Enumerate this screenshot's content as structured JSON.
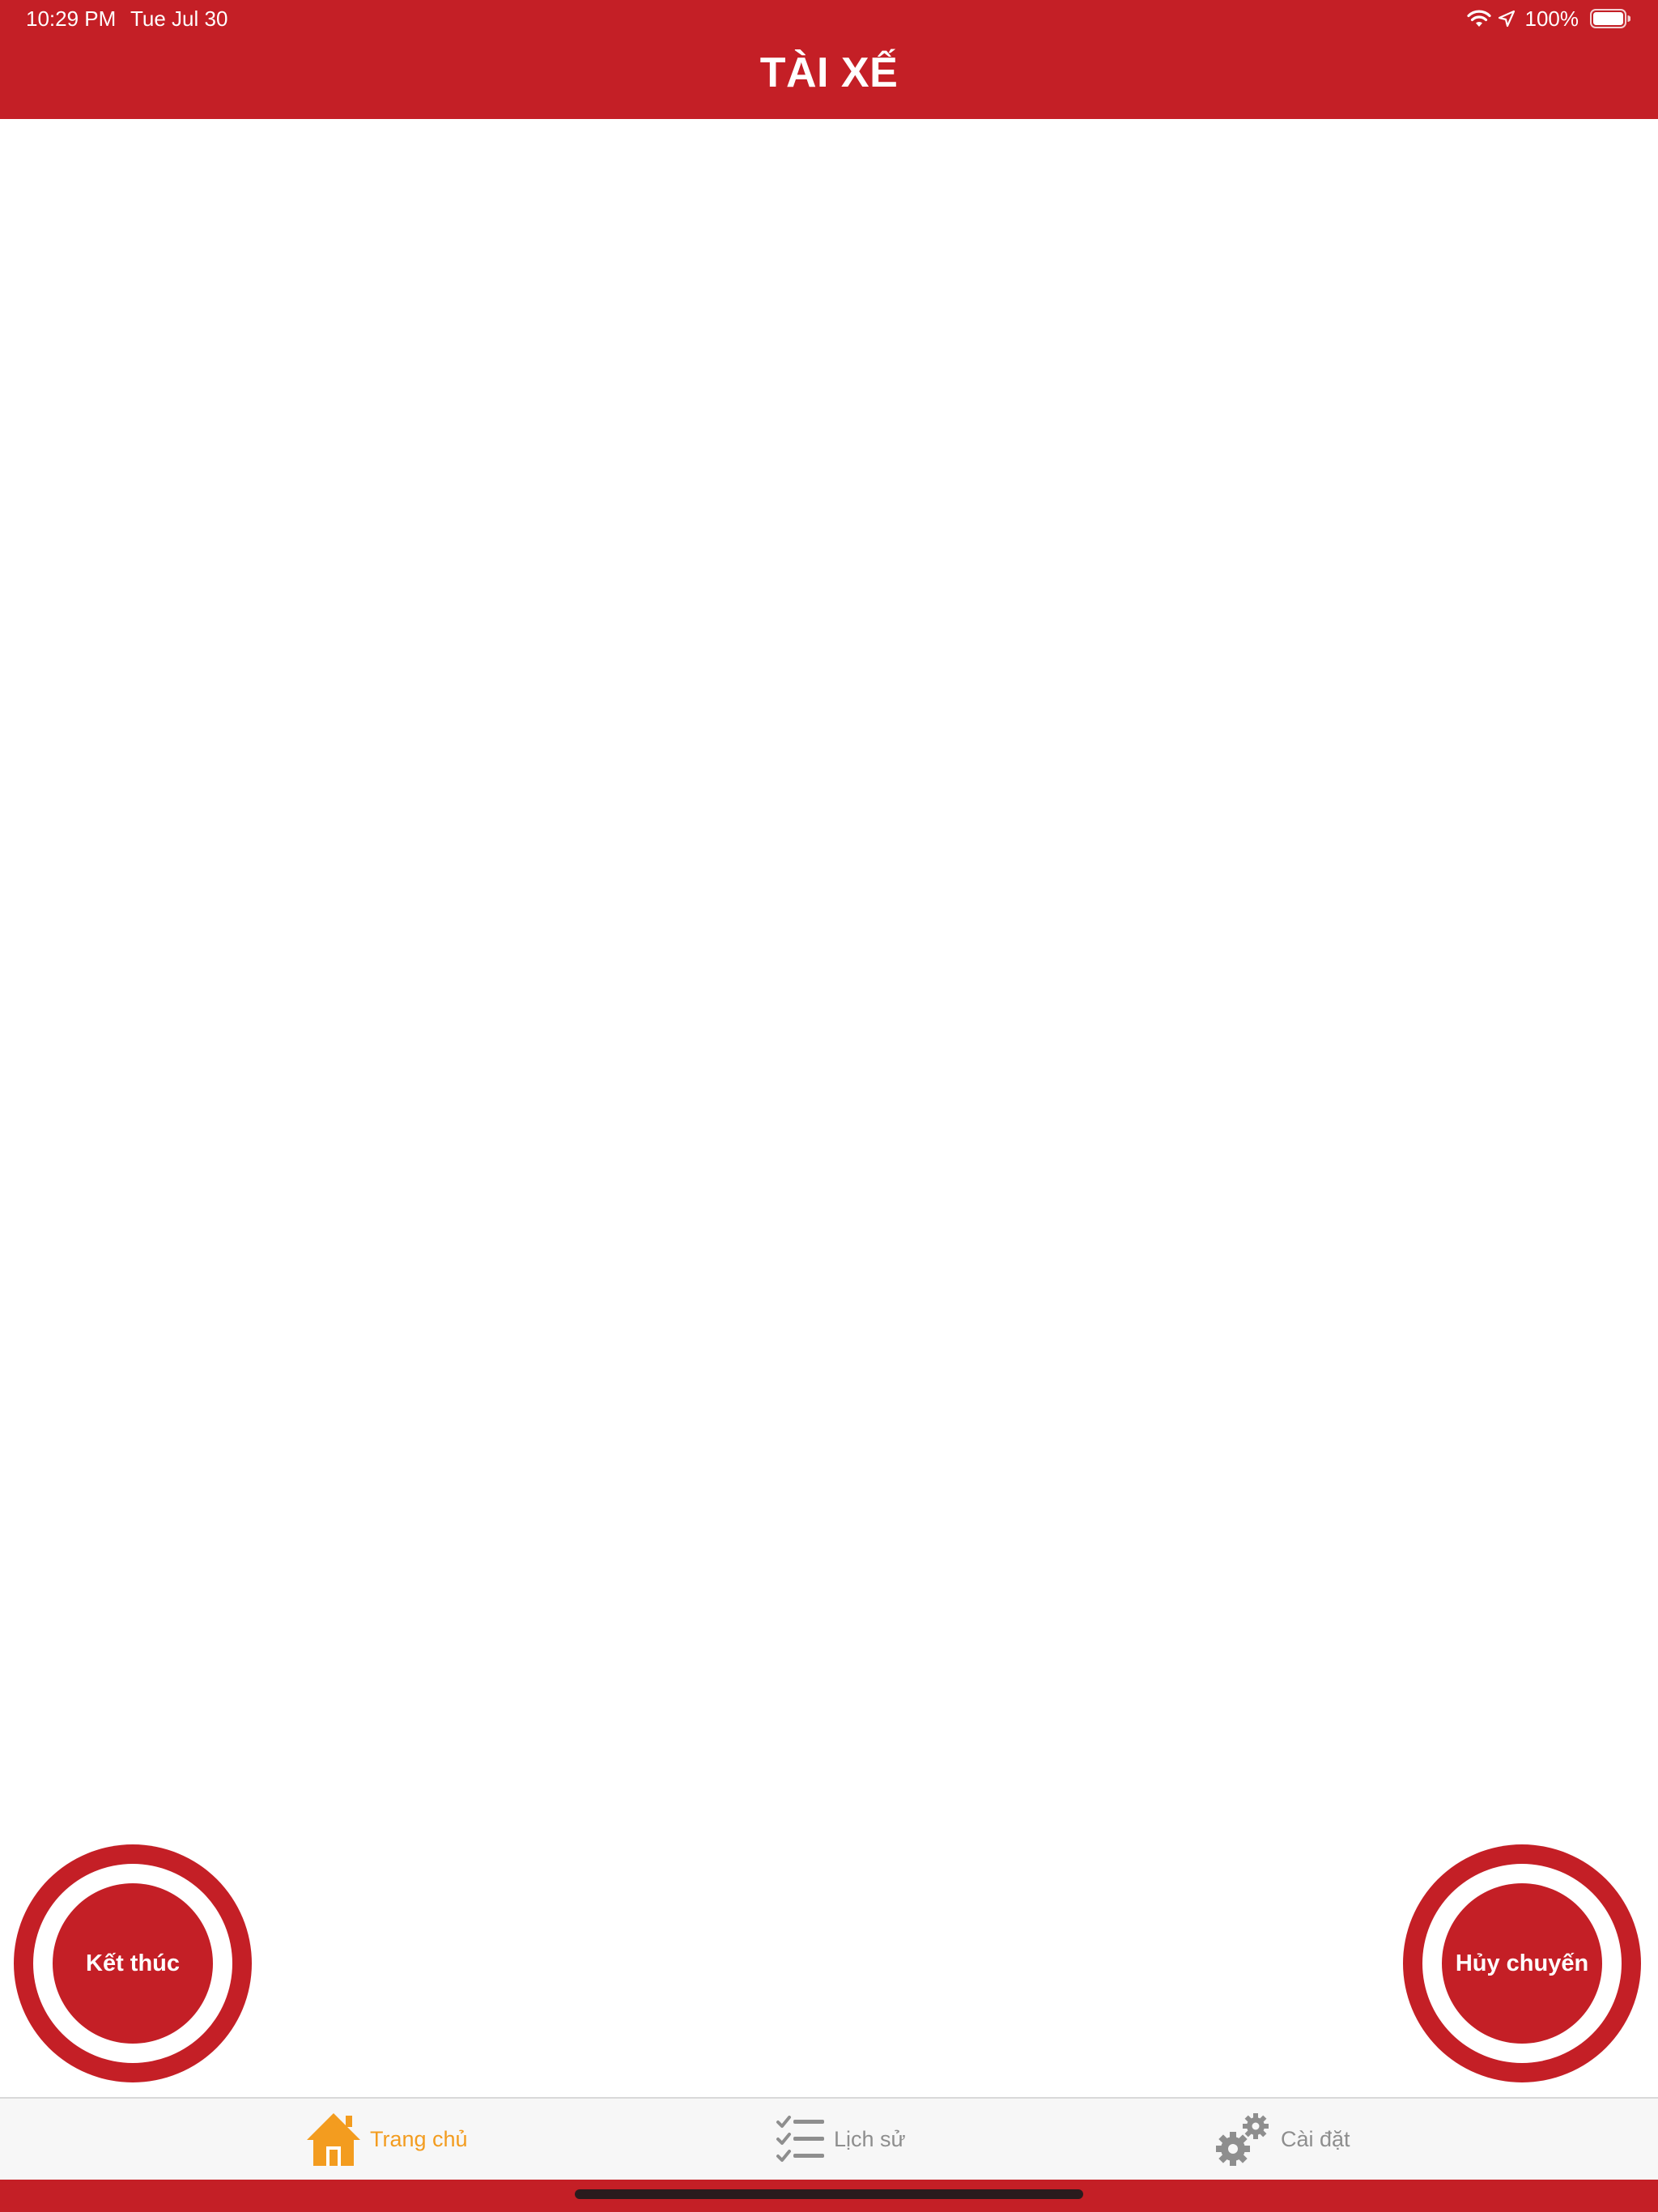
{
  "status_bar": {
    "time": "10:29 PM",
    "date": "Tue Jul 30",
    "battery": "100%",
    "icons": [
      "wifi-icon",
      "location-arrow-icon",
      "battery-icon"
    ]
  },
  "nav": {
    "title": "TÀI XẾ"
  },
  "actions": {
    "end_label": "Kết thúc",
    "cancel_label": "Hủy chuyến"
  },
  "tabbar": {
    "tabs": [
      {
        "label": "Trang chủ",
        "icon": "home-icon",
        "active": true
      },
      {
        "label": "Lịch sử",
        "icon": "checklist-icon",
        "active": false
      },
      {
        "label": "Cài đặt",
        "icon": "gears-icon",
        "active": false
      }
    ]
  },
  "colors": {
    "brand_red": "#c41f26",
    "tab_active": "#f39c1f",
    "tab_inactive": "#8e8e8e",
    "tabbar_bg": "#f7f7f7"
  }
}
